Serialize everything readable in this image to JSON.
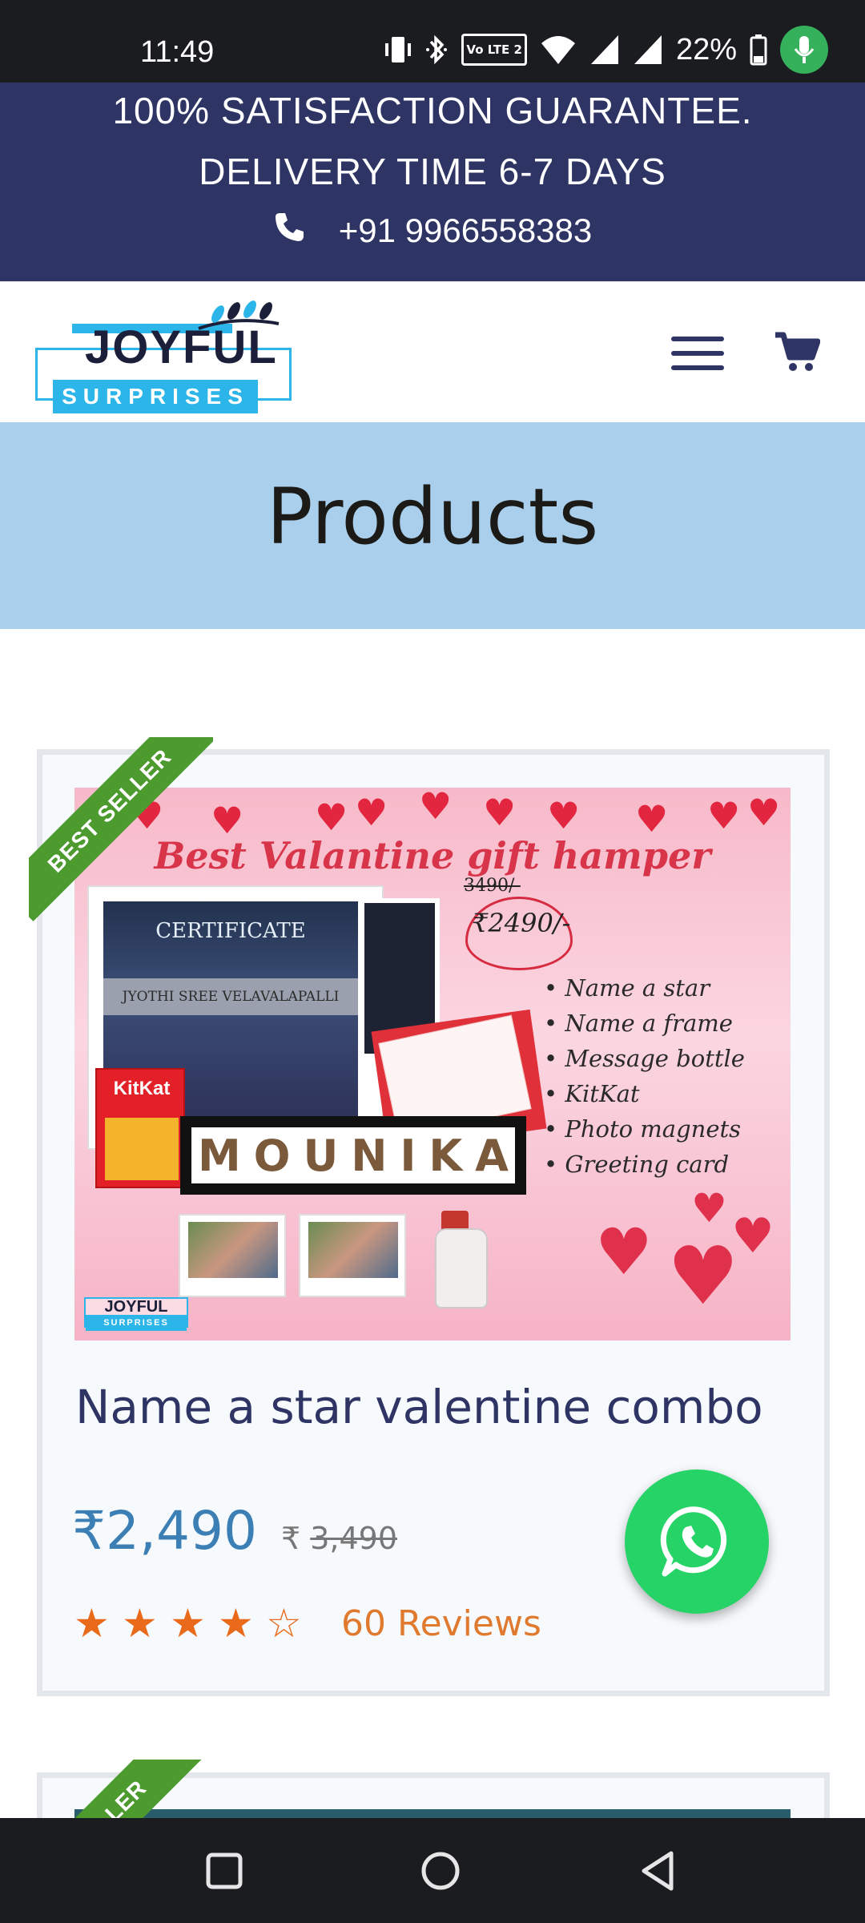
{
  "status_bar": {
    "time": "11:49",
    "battery": "22%",
    "lte_label": "Vo LTE 2",
    "icons": [
      "vibrate-icon",
      "bluetooth-icon",
      "lte-icon",
      "wifi-icon",
      "signal-icon",
      "signal-icon",
      "battery-icon",
      "mic-icon"
    ]
  },
  "banner": {
    "line1": "100% SATISFACTION GUARANTEE.",
    "line2": "DELIVERY TIME 6-7 DAYS",
    "phone": "+91 9966558383",
    "background": "#2e3464"
  },
  "header": {
    "logo_word": "JOYFUL",
    "logo_sub": "SURPRISES",
    "menu_icon": "hamburger-icon",
    "cart_icon": "cart-icon"
  },
  "page": {
    "title": "Products"
  },
  "products": [
    {
      "badge": "BEST SELLER",
      "image": {
        "heading": "Best Valantine gift hamper",
        "old_price": "3490/-",
        "new_price": "₹2490/-",
        "certificate_title": "CERTIFICATE",
        "certificate_name": "JYOTHI SREE VELAVALAPALLI",
        "kitkat_label": "KitKat",
        "frame_letters": [
          "M",
          "O",
          "U",
          "N",
          "I",
          "K",
          "A"
        ],
        "contents": [
          "• Name a star",
          "• Name a frame",
          "• Message bottle",
          "• KitKat",
          "• Photo magnets",
          "• Greeting card"
        ],
        "logo_word": "JOYFUL",
        "logo_sub": "SURPRISES"
      },
      "name": "Name a star valentine combo",
      "price_current": "₹2,490",
      "price_currency": "₹",
      "price_regular": "3,490",
      "rating": 4,
      "rating_max": 5,
      "reviews": "60 Reviews"
    },
    {
      "badge": "SELLER"
    }
  ],
  "whatsapp": {
    "icon": "whatsapp-icon",
    "color": "#25d366"
  },
  "nav_bar": {
    "buttons": [
      "recents-icon",
      "home-icon",
      "back-icon"
    ]
  },
  "colors": {
    "navy": "#2e3464",
    "light_blue": "#a9cfec",
    "price_blue": "#3b7fb5",
    "star_orange": "#ea6a1c",
    "ribbon_green": "#4d9a2f"
  }
}
